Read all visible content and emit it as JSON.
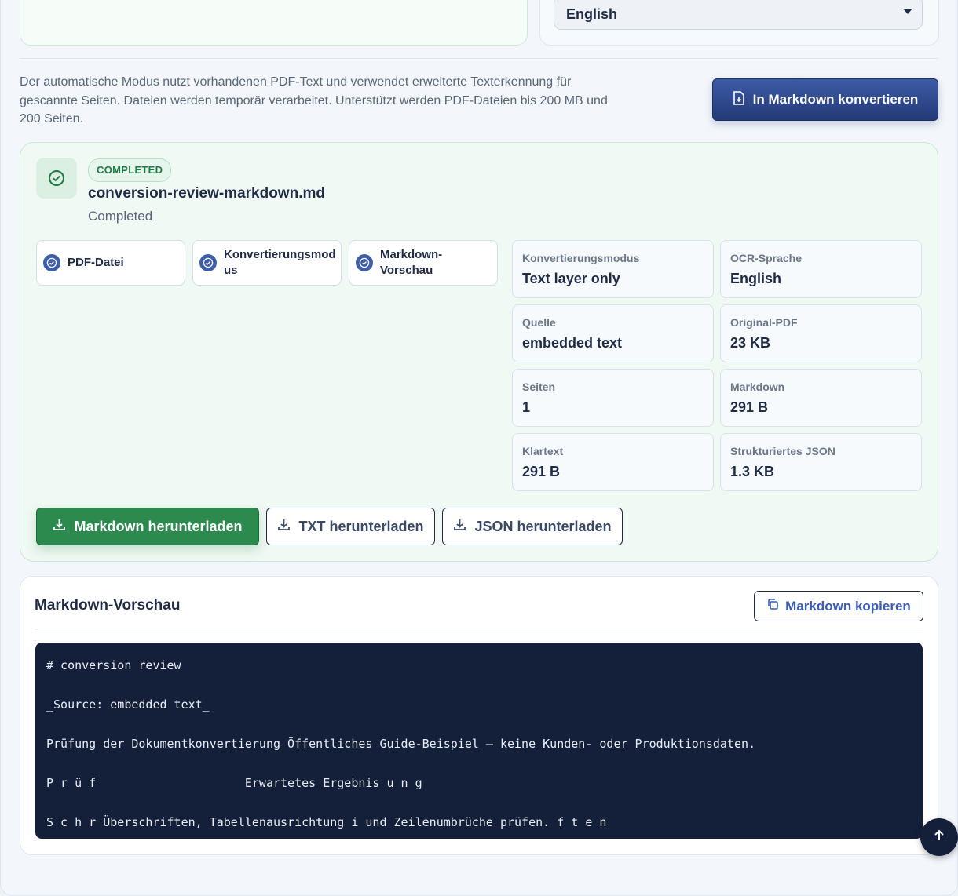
{
  "language_select": {
    "value": "English"
  },
  "info_text": "Der automatische Modus nutzt vorhandenen PDF-Text und verwendet erweiterte Texterkennung für gescannte Seiten. Dateien werden temporär verarbeitet. Unterstützt werden PDF-Dateien bis 200 MB und 200 Seiten.",
  "convert_button": {
    "label": "In Markdown konvertieren",
    "icon": "file-convert-icon"
  },
  "result": {
    "status_badge": "COMPLETED",
    "file_name": "conversion-review-markdown.md",
    "status_text": "Completed",
    "steps": [
      {
        "label": "PDF-Datei",
        "icon": "check-circle-icon"
      },
      {
        "label": "Konvertierungsmod us",
        "icon": "check-circle-icon"
      },
      {
        "label": "Markdown-Vorschau",
        "icon": "check-circle-icon"
      }
    ],
    "meta": [
      {
        "key": "Konvertierungsmodus",
        "value": "Text layer only"
      },
      {
        "key": "OCR-Sprache",
        "value": "English"
      },
      {
        "key": "Quelle",
        "value": "embedded text"
      },
      {
        "key": "Original-PDF",
        "value": "23 KB"
      },
      {
        "key": "Seiten",
        "value": "1"
      },
      {
        "key": "Markdown",
        "value": "291 B"
      },
      {
        "key": "Klartext",
        "value": "291 B"
      },
      {
        "key": "Strukturiertes JSON",
        "value": "1.3 KB"
      }
    ],
    "downloads": {
      "markdown": "Markdown herunterladen",
      "txt": "TXT herunterladen",
      "json": "JSON herunterladen"
    }
  },
  "preview": {
    "title": "Markdown-Vorschau",
    "copy_label": "Markdown kopieren",
    "lines": [
      "# conversion review",
      "_Source: embedded text_",
      "Prüfung der Dokumentkonvertierung Öffentliches Guide-Beispiel — keine Kunden- oder Produktionsdaten.",
      "P r ü f                     Erwartetes Ergebnis u n g",
      "S c h r Überschriften, Tabellenausrichtung i und Zeilenumbrüche prüfen. f t e n"
    ]
  },
  "colors": {
    "accent": "#3f5ea8",
    "success": "#2d8a4e",
    "code_bg": "#141f3a"
  }
}
